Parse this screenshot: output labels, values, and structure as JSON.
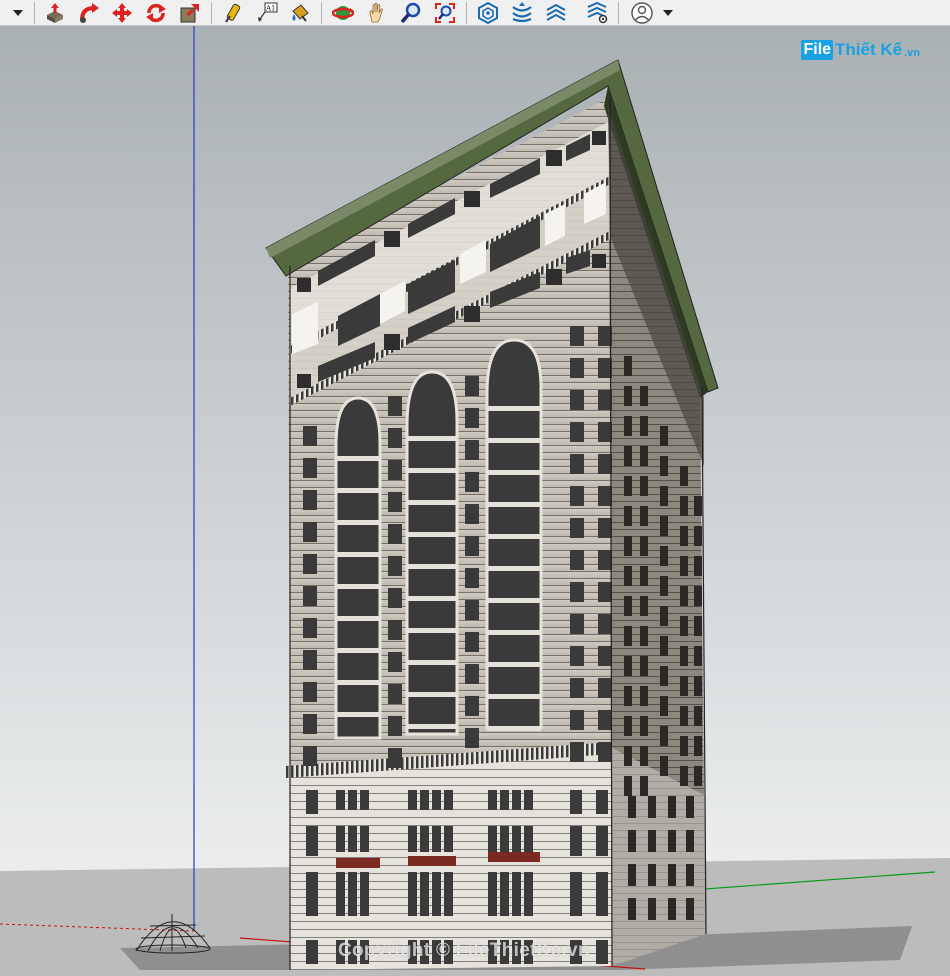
{
  "toolbar": {
    "tools": [
      {
        "name": "dropdown-arrow-icon"
      },
      {
        "name": "push-pull-icon"
      },
      {
        "name": "follow-me-icon"
      },
      {
        "name": "move-icon"
      },
      {
        "name": "rotate-icon"
      },
      {
        "name": "scale-icon"
      },
      {
        "name": "tape-measure-icon"
      },
      {
        "name": "text-label-icon",
        "label": "A1"
      },
      {
        "name": "paint-bucket-icon"
      },
      {
        "name": "orbit-icon"
      },
      {
        "name": "pan-icon"
      },
      {
        "name": "zoom-icon"
      },
      {
        "name": "zoom-extents-icon"
      },
      {
        "name": "sandbox-from-contours-icon"
      },
      {
        "name": "sandbox-smoove-icon"
      },
      {
        "name": "sandbox-stamp-icon"
      },
      {
        "name": "sandbox-drape-icon"
      },
      {
        "name": "account-icon"
      },
      {
        "name": "account-dropdown-icon"
      }
    ]
  },
  "logo": {
    "box": "File",
    "text": "Thiết Kế",
    "suffix": ".vn"
  },
  "watermark": "Copyright © FileThietKe.vn",
  "colors": {
    "sky_top": "#a9b0b4",
    "sky_bottom": "#e9ebec",
    "ground": "#b9b9b9",
    "facade_light": "#d9d5cd",
    "facade_shadow": "#8d8880",
    "cornice": "#5c6e4a",
    "window": "#3a3a3a",
    "axis_blue": "#2f3ac0",
    "axis_green": "#0a9a1a",
    "axis_red": "#c41010"
  }
}
